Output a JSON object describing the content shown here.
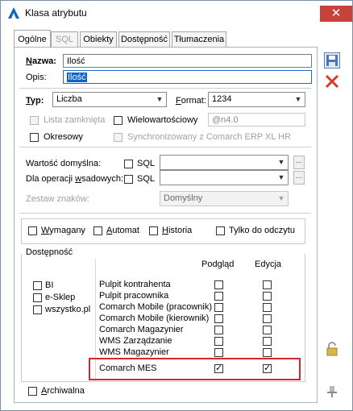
{
  "window": {
    "title": "Klasa atrybutu"
  },
  "tabs": [
    "Ogólne",
    "SQL",
    "Obiekty",
    "Dostępność",
    "Tłumaczenia"
  ],
  "form": {
    "nazwa_label": "Nazwa:",
    "nazwa_value": "Ilość",
    "opis_label": "Opis:",
    "opis_value": "Ilość",
    "typ_label": "Typ:",
    "typ_value": "Liczba",
    "format_label": "Format:",
    "format_value": "1234",
    "lista_zamknieta": "Lista zamknięta",
    "wielowartosciowy": "Wielowartościowy",
    "format_mask": "@n4.0",
    "okresowy": "Okresowy",
    "synchronizowany": "Synchronizowany z Comarch ERP XL HR",
    "wartosc_domyslna_label": "Wartość domyślna:",
    "operacje_label": "Dla operacji wsadowych:",
    "sql_label": "SQL",
    "dots": "...",
    "zestaw_label": "Zestaw znaków:",
    "zestaw_value": "Domyślny",
    "wymagany": "Wymagany",
    "automat": "Automat",
    "historia": "Historia",
    "tylko_do_odczytu": "Tylko do odczytu",
    "dostepnosc_label": "Dostępność",
    "archiwalna": "Archiwalna"
  },
  "access_list": [
    "BI",
    "e-Sklep",
    "wszystko.pl"
  ],
  "access_table": {
    "col_podglad": "Podgląd",
    "col_edycja": "Edycja",
    "rows": [
      {
        "name": "Pulpit kontrahenta",
        "podglad": false,
        "edycja": false
      },
      {
        "name": "Pulpit pracownika",
        "podglad": false,
        "edycja": false
      },
      {
        "name": "Comarch Mobile (pracownik)",
        "podglad": false,
        "edycja": false
      },
      {
        "name": "Comarch Mobile (kierownik)",
        "podglad": false,
        "edycja": false
      },
      {
        "name": "Comarch Magazynier",
        "podglad": false,
        "edycja": false
      },
      {
        "name": "WMS Zarządzanie",
        "podglad": false,
        "edycja": false
      },
      {
        "name": "WMS Magazynier",
        "podglad": false,
        "edycja": false
      },
      {
        "name": "Comarch MES",
        "podglad": true,
        "edycja": true
      }
    ]
  },
  "colors": {
    "accent": "#1565c0",
    "highlight": "#d3262e",
    "close": "#c7423b"
  }
}
